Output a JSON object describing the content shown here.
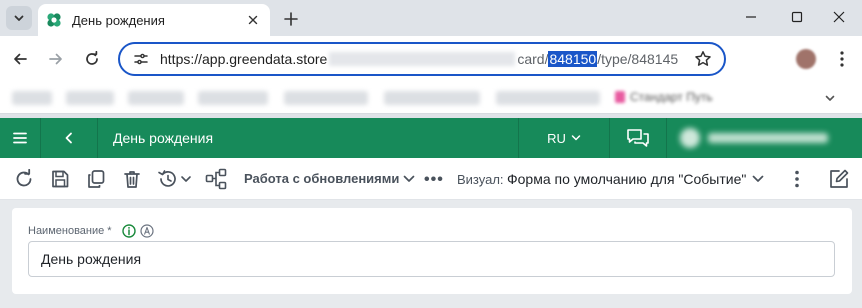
{
  "browser": {
    "tab": {
      "title": "День рождения"
    },
    "url": {
      "prefix": "https://app.greendata.store",
      "middle": "card/",
      "selected": "848150",
      "suffix": "/type/848145"
    },
    "bookmarks_last": "Стандарт Путь"
  },
  "app": {
    "title": "День рождения",
    "language": "RU",
    "colors": {
      "header": "#178a5a",
      "accent": "#1a56c8",
      "info": "#1a8a3c"
    }
  },
  "toolbar": {
    "mode_label": "Работа с обновлениями",
    "more_label": "•••",
    "visual_label": "Визуал:",
    "visual_value": "Форма по умолчанию для \"Событие\""
  },
  "form": {
    "field_label": "Наименование *",
    "field_value": "День рождения"
  }
}
